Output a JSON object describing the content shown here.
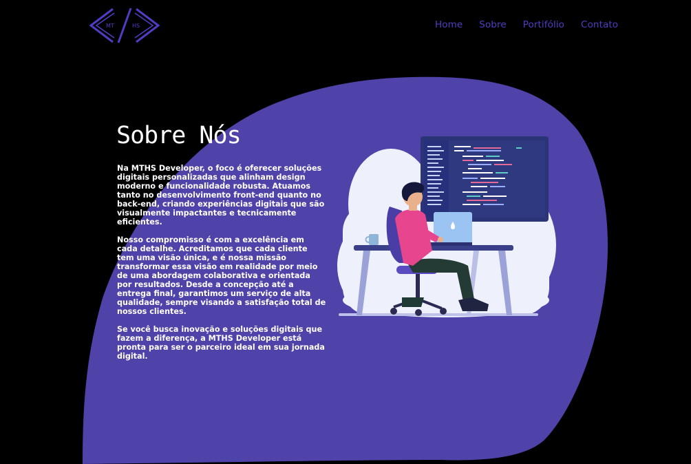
{
  "logo": {
    "left_text": "MT",
    "right_text": "HS"
  },
  "nav": {
    "items": [
      "Home",
      "Sobre",
      "Portifólio",
      "Contato"
    ]
  },
  "about": {
    "title": "Sobre Nós",
    "paragraphs": [
      "Na MTHS Developer, o foco é oferecer soluções digitais personalizadas que alinham design moderno e funcionalidade robusta. Atuamos tanto no desenvolvimento front-end quanto no back-end, criando experiências digitais que são visualmente impactantes e tecnicamente eficientes.",
      "Nosso compromisso é com a excelência em cada detalhe. Acreditamos que cada cliente tem uma visão única, e é nossa missão transformar essa visão em realidade por meio de uma abordagem colaborativa e orientada por resultados. Desde a concepção até a entrega final, garantimos um serviço de alta qualidade, sempre visando a satisfação total de nossos clientes.",
      "Se você busca inovação e soluções digitais que fazem a diferença, a MTHS Developer está pronta para ser o parceiro ideal em sua jornada digital."
    ]
  },
  "colors": {
    "background": "#000000",
    "blob": "#4f42a8",
    "accent": "#4f3dc4",
    "text": "#ffffff"
  },
  "illustration": {
    "name": "developer-at-desk-illustration"
  }
}
